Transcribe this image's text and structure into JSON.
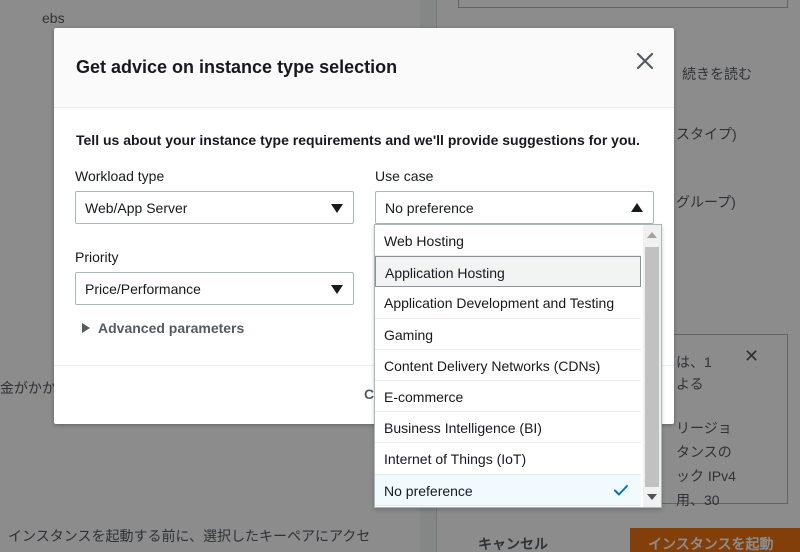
{
  "background": {
    "top_text": "ebs",
    "right_texts": [
      "続きを読む",
      "スタイプ)",
      "グループ)",
      "は、1",
      "よる",
      "リージョ",
      "タンスの",
      "ック IPv4",
      "用、30"
    ],
    "left_text": "金がかか",
    "bottom_text": "インスタンスを起動する前に、選択したキーペアにアクセ",
    "cancel_label": "キャンセル",
    "launch_label": "インスタンスを起動"
  },
  "modal": {
    "title": "Get advice on instance type selection",
    "description": "Tell us about your instance type requirements and we'll provide suggestions for you.",
    "workload": {
      "label": "Workload type",
      "value": "Web/App Server"
    },
    "use_case": {
      "label": "Use case",
      "value": "No preference"
    },
    "priority": {
      "label": "Priority",
      "value": "Price/Performance"
    },
    "advanced_label": "Advanced parameters",
    "footer_cancel": "C"
  },
  "dropdown": {
    "options": [
      {
        "label": "Web Hosting"
      },
      {
        "label": "Application Hosting"
      },
      {
        "label": "Application Development and Testing"
      },
      {
        "label": "Gaming"
      },
      {
        "label": "Content Delivery Networks (CDNs)"
      },
      {
        "label": "E-commerce"
      },
      {
        "label": "Business Intelligence (BI)"
      },
      {
        "label": "Internet of Things (IoT)"
      },
      {
        "label": "No preference"
      }
    ],
    "hovered_option": "Application Hosting",
    "selected_option": "No preference"
  },
  "colors": {
    "accent": "#0073bb",
    "primary_button": "#ec7211"
  }
}
